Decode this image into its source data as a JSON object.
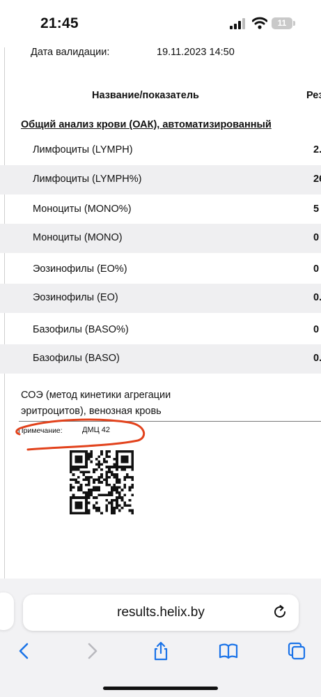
{
  "status_bar": {
    "time": "21:45",
    "battery": "11"
  },
  "document": {
    "validation_label": "Дата валидации:",
    "validation_value": "19.11.2023  14:50",
    "header_name": "Название/показатель",
    "header_result": "Рез",
    "section_title": "Общий анализ крови (ОАК), автоматизированный",
    "rows": [
      {
        "label": "Лимфоциты (LYMPH)",
        "value": "2."
      },
      {
        "label": "Лимфоциты (LYMPH%)",
        "value": "26"
      },
      {
        "label": "Моноциты (MONO%)",
        "value": "5"
      },
      {
        "label": "Моноциты (MONO)",
        "value": "0"
      },
      {
        "label": "Эозинофилы (EO%)",
        "value": "0"
      },
      {
        "label": "Эозинофилы (EO)",
        "value": "0."
      },
      {
        "label": "Базофилы (BASO%)",
        "value": "0"
      },
      {
        "label": "Базофилы (BASO)",
        "value": "0."
      }
    ],
    "esr_line1": "СОЭ (метод кинетики агрегации",
    "esr_line2": "эритроцитов), венозная кровь",
    "note_label": "Примечание:",
    "note_value": "ДМЦ 42"
  },
  "browser": {
    "url": "results.helix.by",
    "accent_color": "#1a73e8"
  }
}
